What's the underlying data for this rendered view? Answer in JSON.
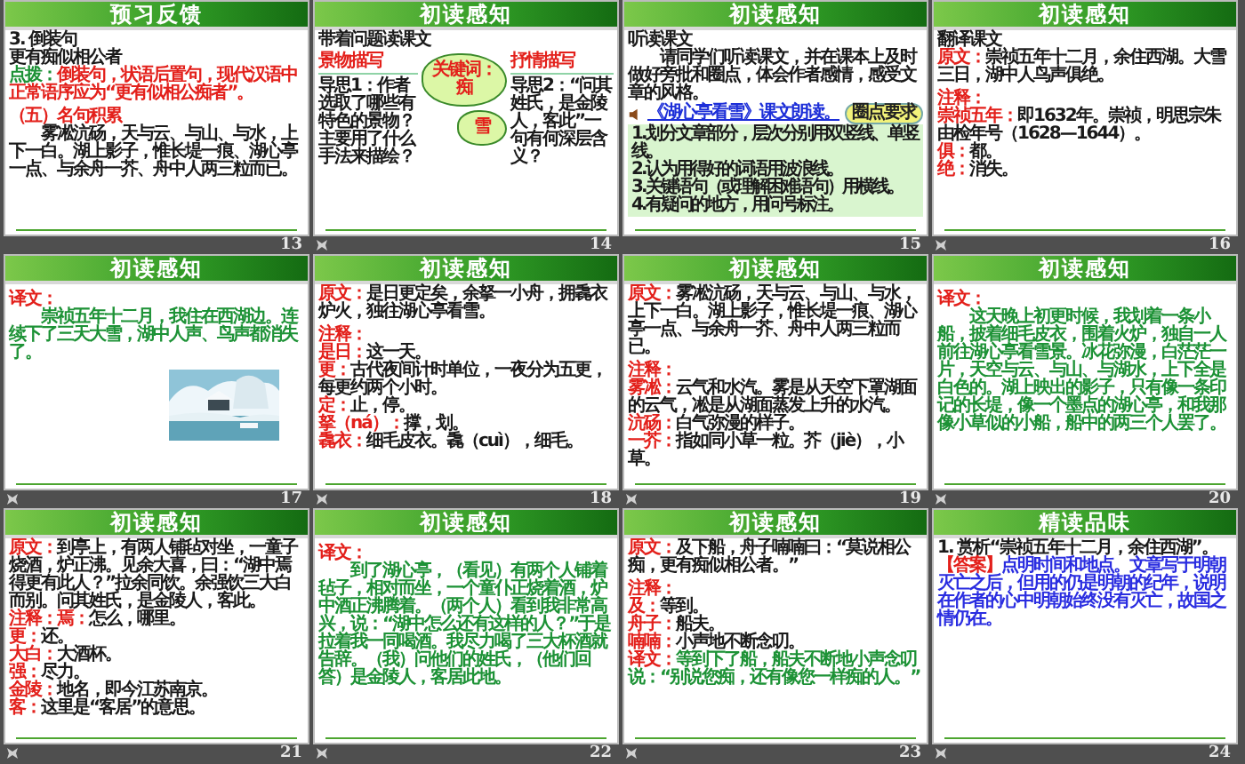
{
  "slides": [
    {
      "number": "13",
      "title": "预习反馈",
      "animated": false,
      "blocks": [
        {
          "kind": "line",
          "color": "#1a1a1a",
          "text": "3. 倒装句"
        },
        {
          "kind": "line",
          "color": "#1a1a1a",
          "text": "更有痴似相公者"
        },
        {
          "kind": "note",
          "color": "#e3201b",
          "label": {
            "text": "点拨：",
            "color": "#1d9236"
          },
          "text": "倒装句，状语后置句，现代汉语中正常语序应为“更有似相公痴者”。"
        },
        {
          "kind": "heading",
          "color": "#e3201b",
          "text": "（五）名句积累"
        },
        {
          "kind": "para",
          "color": "#1a1a1a",
          "text": "雾凇沆砀，天与云、与山、与水，上下一白。湖上影子，惟长堤一痕、湖心亭一点、与余舟一芥、舟中人两三粒而已。"
        }
      ]
    },
    {
      "number": "14",
      "title": "初读感知",
      "animated": true,
      "blocks": [
        {
          "kind": "diagram",
          "heading": "带着问题读课文",
          "left_label": "景物描写",
          "left_text": "导思1：作者选取了哪些有特色的景物？主要用了什么手法来描绘？",
          "cloud_top": "关键词：痴",
          "cloud_bottom": "雪",
          "right_label": "抒情描写",
          "right_text": "导思2：“问其姓氏，是金陵人，客此”一句有何深层含义？"
        }
      ]
    },
    {
      "number": "15",
      "title": "初读感知",
      "animated": false,
      "blocks": [
        {
          "kind": "line",
          "color": "#1a1a1a",
          "text": "听读课文"
        },
        {
          "kind": "para",
          "color": "#1a1a1a",
          "text": "请同学们听读课文，并在课本上及时做好旁批和圈点，体会作者感情，感受文章的风格。"
        },
        {
          "kind": "link",
          "text": "《湖心亭看雪》课文朗读。",
          "badge": "圈点要求"
        },
        {
          "kind": "box",
          "items": [
            "1.划分文章部分，层次分别用双竖线、单竖线。",
            "2.认为用得好的词语用波浪线。",
            "3.关键语句（或理解困难语句）用横线。",
            "4.有疑问的地方，用问号标注。"
          ]
        }
      ]
    },
    {
      "number": "16",
      "title": "初读感知",
      "animated": true,
      "blocks": [
        {
          "kind": "line",
          "color": "#1a1a1a",
          "text": "翻译课文"
        },
        {
          "kind": "note",
          "color": "#1a1a1a",
          "label": {
            "text": "原文：",
            "color": "#e3201b"
          },
          "text": "崇祯五年十二月，余住西湖。大雪三日，湖中人鸟声俱绝。"
        },
        {
          "kind": "heading",
          "color": "#e3201b",
          "text": "注释："
        },
        {
          "kind": "note",
          "color": "#1a1a1a",
          "label": {
            "text": "崇祯五年：",
            "color": "#e3201b"
          },
          "text": "即1632年。崇祯，明思宗朱由检年号（1628—1644）。"
        },
        {
          "kind": "note",
          "color": "#1a1a1a",
          "label": {
            "text": "俱：",
            "color": "#e3201b"
          },
          "text": "都。"
        },
        {
          "kind": "note",
          "color": "#1a1a1a",
          "label": {
            "text": "绝：",
            "color": "#e3201b"
          },
          "text": "消失。"
        }
      ]
    },
    {
      "number": "17",
      "title": "初读感知",
      "animated": true,
      "blocks": [
        {
          "kind": "heading",
          "color": "#e3201b",
          "text": "译文："
        },
        {
          "kind": "para",
          "color": "#1d9236",
          "text": "崇祯五年十二月，我住在西湖边。连续下了三天大雪，湖中人声、鸟声都消失了。"
        },
        {
          "kind": "picture"
        }
      ]
    },
    {
      "number": "18",
      "title": "初读感知",
      "animated": true,
      "blocks": [
        {
          "kind": "note",
          "color": "#1a1a1a",
          "label": {
            "text": "原文：",
            "color": "#e3201b"
          },
          "text": "是日更定矣，余拏一小舟，拥毳衣炉火，独往湖心亭看雪。"
        },
        {
          "kind": "heading",
          "color": "#e3201b",
          "text": "注释："
        },
        {
          "kind": "note",
          "color": "#1a1a1a",
          "label": {
            "text": "是日：",
            "color": "#e3201b"
          },
          "text": "这一天。"
        },
        {
          "kind": "note",
          "color": "#1a1a1a",
          "label": {
            "text": "更：",
            "color": "#e3201b"
          },
          "text": "古代夜间计时单位，一夜分为五更，每更约两个小时。"
        },
        {
          "kind": "note",
          "color": "#1a1a1a",
          "label": {
            "text": "定：",
            "color": "#e3201b"
          },
          "text": "止，停。"
        },
        {
          "kind": "note",
          "color": "#1a1a1a",
          "label": {
            "text": "拏（ná）：",
            "color": "#e3201b"
          },
          "text": "撑，划。"
        },
        {
          "kind": "note",
          "color": "#1a1a1a",
          "label": {
            "text": "毳衣：",
            "color": "#e3201b"
          },
          "text": "细毛皮衣。毳（cuì），细毛。"
        }
      ]
    },
    {
      "number": "19",
      "title": "初读感知",
      "animated": true,
      "blocks": [
        {
          "kind": "note",
          "color": "#1a1a1a",
          "label": {
            "text": "原文：",
            "color": "#e3201b"
          },
          "text": "雾凇沆砀，天与云、与山、与水，上下一白。湖上影子，惟长堤一痕、湖心亭一点、与余舟一芥、舟中人两三粒而已。"
        },
        {
          "kind": "heading",
          "color": "#e3201b",
          "text": "注释："
        },
        {
          "kind": "note",
          "color": "#1a1a1a",
          "label": {
            "text": "雾凇：",
            "color": "#e3201b"
          },
          "text": "云气和水汽。雾是从天空下罩湖面的云气，凇是从湖面蒸发上升的水汽。"
        },
        {
          "kind": "note",
          "color": "#1a1a1a",
          "label": {
            "text": "沆砀：",
            "color": "#e3201b"
          },
          "text": "白气弥漫的样子。"
        },
        {
          "kind": "note",
          "color": "#1a1a1a",
          "label": {
            "text": "一芥：",
            "color": "#e3201b"
          },
          "text": "指如同小草一粒。芥（jiè），小草。"
        }
      ]
    },
    {
      "number": "20",
      "title": "初读感知",
      "animated": true,
      "blocks": [
        {
          "kind": "heading",
          "color": "#e3201b",
          "text": "译文："
        },
        {
          "kind": "para",
          "color": "#1d9236",
          "text": "这天晚上初更时候，我划着一条小船，披着细毛皮衣，围着火炉，独自一人前往湖心亭看雪景。冰花弥漫，白茫茫一片，天空与云、与山、与湖水，上下全是白色的。湖上映出的影子，只有像一条印记的长堤，像一个墨点的湖心亭，和我那像小草似的小船，船中的两三个人罢了。"
        }
      ]
    },
    {
      "number": "21",
      "title": "初读感知",
      "animated": true,
      "blocks": [
        {
          "kind": "note",
          "color": "#1a1a1a",
          "label": {
            "text": "原文：",
            "color": "#e3201b"
          },
          "text": "到亭上，有两人铺毡对坐，一童子烧酒，炉正沸。见余大喜，曰：“湖中焉得更有此人？”拉余同饮。余强饮三大白而别。问其姓氏，是金陵人，客此。"
        },
        {
          "kind": "note",
          "color": "#1a1a1a",
          "label": {
            "text": "注释：焉：",
            "color": "#e3201b"
          },
          "text": "怎么，哪里。"
        },
        {
          "kind": "note",
          "color": "#1a1a1a",
          "label": {
            "text": "更：",
            "color": "#e3201b"
          },
          "text": "还。"
        },
        {
          "kind": "note",
          "color": "#1a1a1a",
          "label": {
            "text": "大白：",
            "color": "#e3201b"
          },
          "text": "大酒杯。"
        },
        {
          "kind": "note",
          "color": "#1a1a1a",
          "label": {
            "text": "强：",
            "color": "#e3201b"
          },
          "text": "尽力。"
        },
        {
          "kind": "note",
          "color": "#1a1a1a",
          "label": {
            "text": "金陵：",
            "color": "#e3201b"
          },
          "text": "地名，即今江苏南京。"
        },
        {
          "kind": "note",
          "color": "#1a1a1a",
          "label": {
            "text": "客：",
            "color": "#e3201b"
          },
          "text": "这里是“客居”的意思。"
        }
      ]
    },
    {
      "number": "22",
      "title": "初读感知",
      "animated": true,
      "blocks": [
        {
          "kind": "heading",
          "color": "#e3201b",
          "text": "译文："
        },
        {
          "kind": "para",
          "color": "#1d9236",
          "text": "到了湖心亭，（看见）有两个人铺着毡子，相对而坐，一个童仆正烧着酒，炉中酒正沸腾着。（两个人）看到我非常高兴，说：“湖中怎么还有这样的人？”于是拉着我一同喝酒。我尽力喝了三大杯酒就告辞。（我）问他们的姓氏，（他们回答）是金陵人，客居此地。"
        }
      ]
    },
    {
      "number": "23",
      "title": "初读感知",
      "animated": true,
      "blocks": [
        {
          "kind": "note",
          "color": "#1a1a1a",
          "label": {
            "text": "原文：",
            "color": "#e3201b"
          },
          "text": "及下船，舟子喃喃曰：“莫说相公痴，更有痴似相公者。”"
        },
        {
          "kind": "heading",
          "color": "#e3201b",
          "text": "注释："
        },
        {
          "kind": "note",
          "color": "#1a1a1a",
          "label": {
            "text": "及：",
            "color": "#e3201b"
          },
          "text": "等到。"
        },
        {
          "kind": "note",
          "color": "#1a1a1a",
          "label": {
            "text": "舟子：",
            "color": "#e3201b"
          },
          "text": "船夫。"
        },
        {
          "kind": "note",
          "color": "#1a1a1a",
          "label": {
            "text": "喃喃：",
            "color": "#e3201b"
          },
          "text": "小声地不断念叨。"
        },
        {
          "kind": "note",
          "color": "#1d9236",
          "label": {
            "text": "译文：",
            "color": "#e3201b"
          },
          "text": "等到下了船，船夫不断地小声念叨说：“别说您痴，还有像您一样痴的人。”"
        }
      ]
    },
    {
      "number": "24",
      "title": "精读品味",
      "animated": true,
      "blocks": [
        {
          "kind": "line",
          "color": "#1a1a1a",
          "text": "1. 赏析“崇祯五年十二月，余住西湖”。"
        },
        {
          "kind": "note",
          "color": "#2a2de0",
          "label": {
            "text": "【答案】",
            "color": "#e3201b"
          },
          "text": "点明时间和地点。文章写于明朝灭亡之后，但用的仍是明朝的纪年，说明在作者的心中明朝始终没有灭亡，故国之情仍在。"
        }
      ]
    }
  ]
}
